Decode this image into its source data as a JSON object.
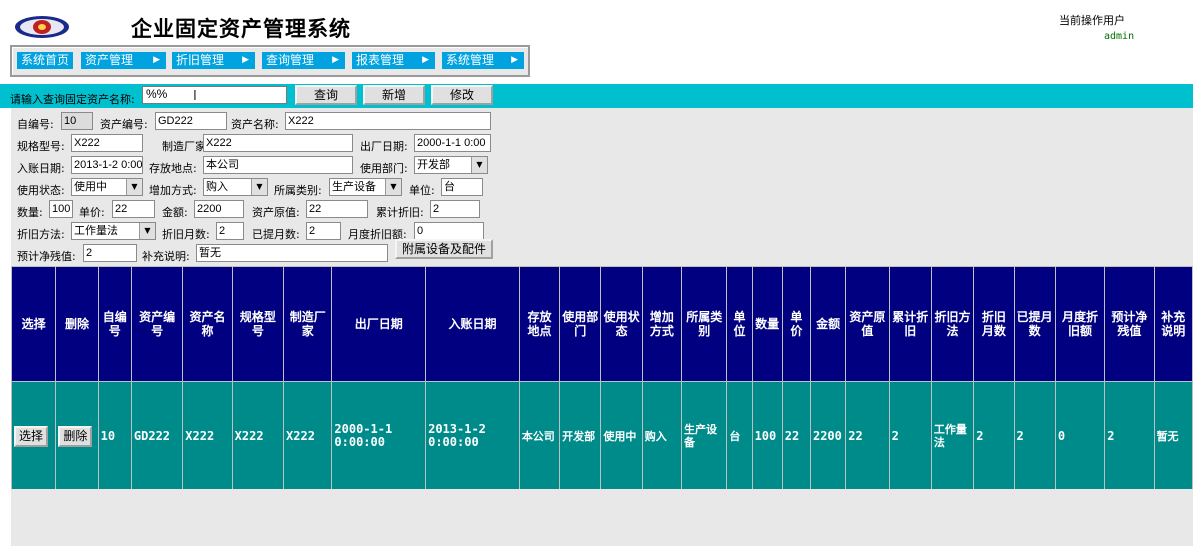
{
  "header": {
    "title": "企业固定资产管理系统",
    "user_label": "当前操作用户",
    "user_name": "admin",
    "logo_icon": "emblem-logo"
  },
  "menu": [
    {
      "label": "系统首页",
      "arrow": ""
    },
    {
      "label": "资产管理",
      "arrow": "▶"
    },
    {
      "label": "折旧管理",
      "arrow": "▶"
    },
    {
      "label": "查询管理",
      "arrow": "▶"
    },
    {
      "label": "报表管理",
      "arrow": "▶"
    },
    {
      "label": "系统管理",
      "arrow": "▶"
    }
  ],
  "search": {
    "label": "请输入查询固定资产名称:",
    "value": "%%",
    "query_btn": "查询",
    "add_btn": "新增",
    "edit_btn": "修改"
  },
  "form": {
    "id_label": "自编号:",
    "id": "10",
    "code_label": "资产编号:",
    "code": "GD222",
    "name_label": "资产名称:",
    "name": "X222",
    "spec_label": "规格型号:",
    "spec": "X222",
    "maker_label": "制造厂家:",
    "maker": "X222",
    "factory_date_label": "出厂日期:",
    "factory_date": "2000-1-1 0:00",
    "entry_date_label": "入账日期:",
    "entry_date": "2013-1-2 0:00",
    "location_label": "存放地点:",
    "location": "本公司",
    "dept_label": "使用部门:",
    "dept": "开发部",
    "status_label": "使用状态:",
    "status": "使用中",
    "add_method_label": "增加方式:",
    "add_method": "购入",
    "category_label": "所属类别:",
    "category": "生产设备",
    "unit_label": "单位:",
    "unit": "台",
    "qty_label": "数量:",
    "qty": "100",
    "price_label": "单价:",
    "price": "22",
    "amount_label": "金额:",
    "amount": "2200",
    "original_label": "资产原值:",
    "original": "22",
    "accum_label": "累计折旧:",
    "accum": "2",
    "method_label": "折旧方法:",
    "method": "工作量法",
    "months_label": "折旧月数:",
    "months": "2",
    "used_months_label": "已提月数:",
    "used_months": "2",
    "monthly_label": "月度折旧额:",
    "monthly": "0",
    "residual_label": "预计净残值:",
    "residual": "2",
    "note_label": "补充说明:",
    "note": "暂无",
    "accessory_btn": "附属设备及配件"
  },
  "table": {
    "headers": [
      "选择",
      "删除",
      "自编号",
      "资产编号",
      "资产名称",
      "规格型号",
      "制造厂家",
      "出厂日期",
      "入账日期",
      "存放地点",
      "使用部门",
      "使用状态",
      "增加方式",
      "所属类别",
      "单位",
      "数量",
      "单价",
      "金额",
      "资产原值",
      "累计折旧",
      "折旧方法",
      "折旧月数",
      "已提月数",
      "月度折旧额",
      "预计净残值",
      "补充说明"
    ],
    "row": {
      "select_btn": "选择",
      "delete_btn": "删除",
      "id": "10",
      "code": "GD222",
      "name": "X222",
      "spec": "X222",
      "maker": "X222",
      "factory_date": "2000-1-1 0:00:00",
      "entry_date": "2013-1-2 0:00:00",
      "location": "本公司",
      "dept": "开发部",
      "status": "使用中",
      "add_method": "购入",
      "category": "生产设备",
      "unit": "台",
      "qty": "100",
      "price": "22",
      "amount": "2200",
      "original": "22",
      "accum": "2",
      "method": "工作量法",
      "months": "2",
      "used_months": "2",
      "monthly": "0",
      "residual": "2",
      "note": "暂无"
    }
  }
}
